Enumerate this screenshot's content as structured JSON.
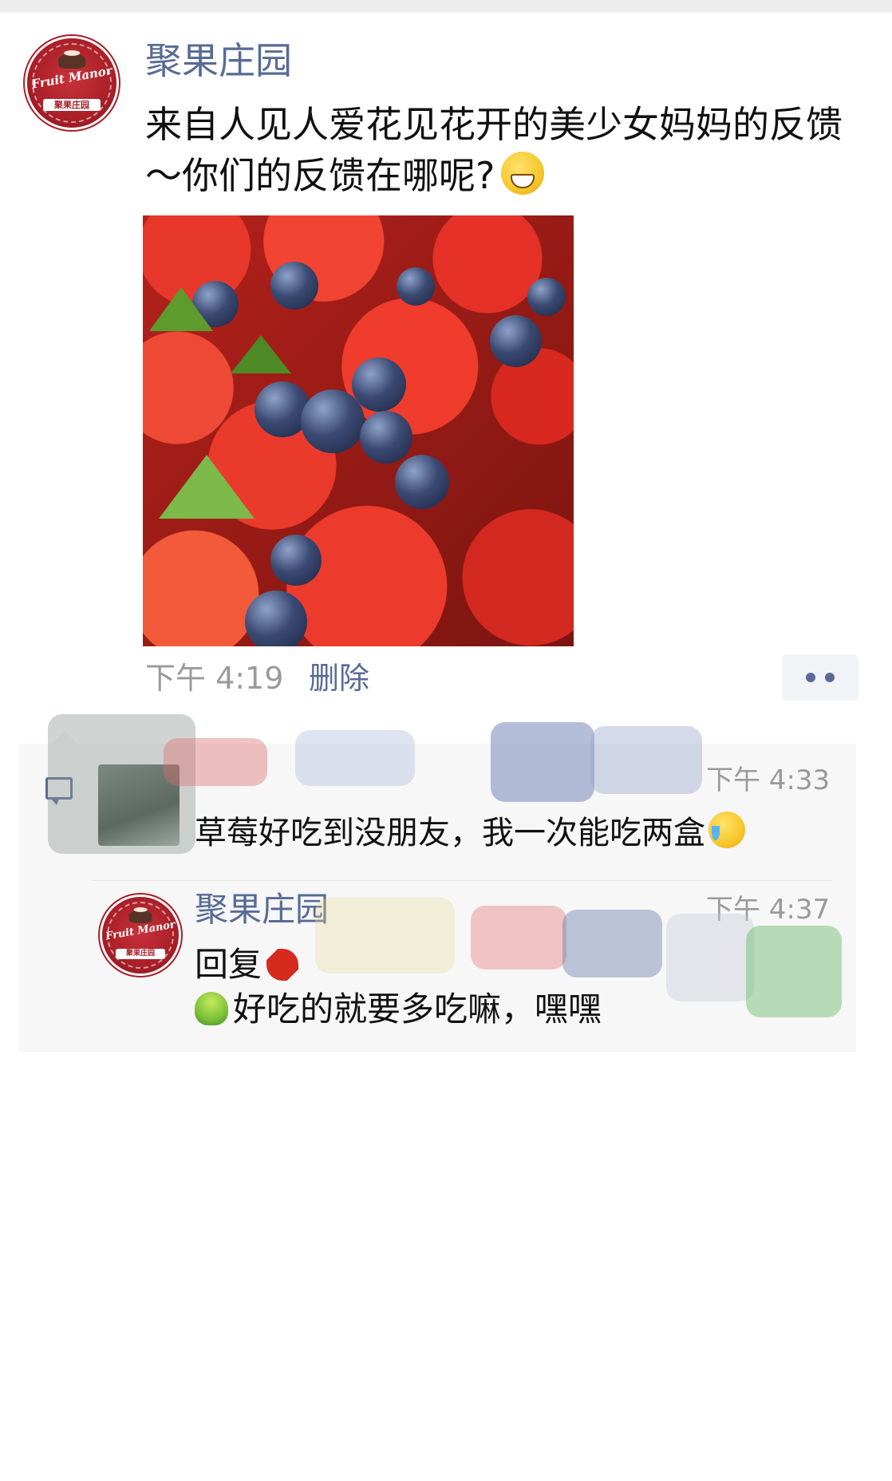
{
  "post": {
    "author": "聚果庄园",
    "avatar_script_text": "Fruit Manor",
    "avatar_cn_text": "聚果庄园",
    "text": "来自人见人爱花见花开的美少女妈妈的反馈～你们的反馈在哪呢?",
    "text_emoji": "grin-emoji",
    "photo": "strawberries-and-blueberries-photo",
    "time": "下午 4:19",
    "delete_label": "删除"
  },
  "comments": [
    {
      "author": "",
      "time": "下午 4:33",
      "text": "草莓好吃到没朋友，我一次能吃两盒",
      "emoji": "laugh-cry-emoji"
    }
  ],
  "reply": {
    "author": "聚果庄园",
    "time": "下午 4:37",
    "prefix": "回复",
    "text": "好吃的就要多吃嘛，嘿嘿"
  }
}
